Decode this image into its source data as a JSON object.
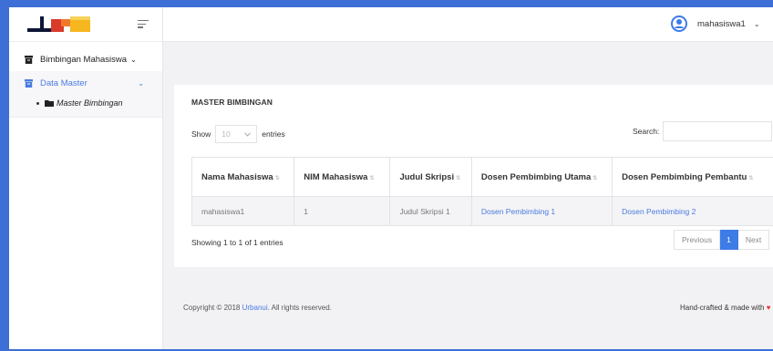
{
  "sidebar": {
    "logo": "logo",
    "items": [
      {
        "label": "Bimbingan Mahasiswa",
        "icon": "archive-icon",
        "chevron": "⌄"
      },
      {
        "label": "Data Master",
        "icon": "archive-icon",
        "chevron": "⌄"
      }
    ],
    "submenu": [
      {
        "label": "Master Bimbingan",
        "icon": "folder-icon"
      }
    ]
  },
  "topbar": {
    "user_name": "mahasiswa1",
    "user_chevron": "⌄"
  },
  "card": {
    "title": "MASTER BIMBINGAN",
    "show_label": "Show",
    "entries_label": "entries",
    "page_size": "10",
    "search_label": "Search:",
    "search_value": "",
    "columns": [
      "Nama Mahasiswa",
      "NIM Mahasiswa",
      "Judul Skripsi",
      "Dosen Pembimbing Utama",
      "Dosen Pembimbing Pembantu"
    ],
    "rows": [
      [
        "mahasiswa1",
        "1",
        "Judul Skripsi 1",
        "Dosen Pembimbing 1",
        "Dosen Pembimbing 2"
      ]
    ],
    "info": "Showing 1 to 1 of 1 entries",
    "pagination": {
      "previous": "Previous",
      "current": "1",
      "next": "Next"
    }
  },
  "footer": {
    "copyright_prefix": "Copyright © 2018 ",
    "copyright_link": "Urbanui",
    "copyright_suffix": ". All rights reserved.",
    "right_text": "Hand-crafted & made with ",
    "heart": "♥"
  },
  "colors": {
    "accent": "#3d7be7",
    "frame_bg": "#3d6fd6",
    "link": "#4a7be0"
  }
}
